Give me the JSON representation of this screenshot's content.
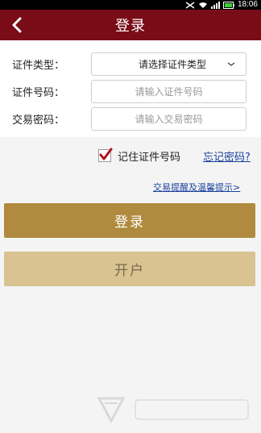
{
  "status_bar": {
    "time": "18:06"
  },
  "header": {
    "title": "登录"
  },
  "form": {
    "cert_type_label": "证件类型：",
    "cert_type_value": "请选择证件类型",
    "cert_number_label": "证件号码：",
    "cert_number_placeholder": "请输入证件号码",
    "trade_password_label": "交易密码：",
    "trade_password_placeholder": "请输入交易密码"
  },
  "options": {
    "remember_label": "记住证件号码",
    "remember_checked": true,
    "forgot_link": "忘记密码?",
    "tips_link": "交易提醒及温馨提示>"
  },
  "buttons": {
    "login": "登录",
    "open_account": "开户"
  },
  "icons": {
    "back": "back-arrow-icon",
    "dropdown": "chevron-down-icon",
    "check": "checkmark-icon"
  },
  "colors": {
    "header_bg": "#7a0c17",
    "login_button": "#b08a3e",
    "open_button": "#d8c391",
    "link": "#1a3f9c"
  }
}
